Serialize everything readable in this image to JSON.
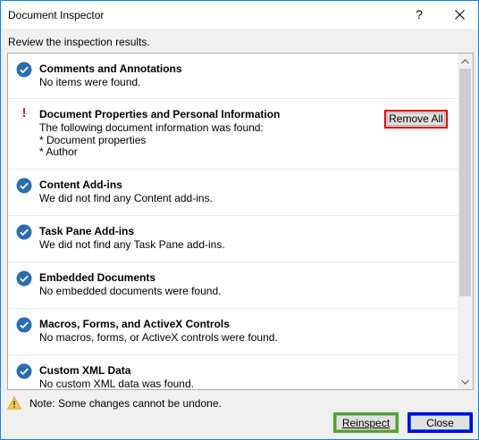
{
  "window": {
    "title": "Document Inspector",
    "help_label": "?",
    "subtitle": "Review the inspection results."
  },
  "items": [
    {
      "name": "Comments and Annotations",
      "status": "ok",
      "description": "No items were found."
    },
    {
      "name": "Document Properties and Personal Information",
      "status": "warning",
      "description": "The following document information was found:\n* Document properties\n* Author",
      "action_label": "Remove All"
    },
    {
      "name": "Content Add-ins",
      "status": "ok",
      "description": "We did not find any Content add-ins."
    },
    {
      "name": "Task Pane Add-ins",
      "status": "ok",
      "description": "We did not find any Task Pane add-ins."
    },
    {
      "name": "Embedded Documents",
      "status": "ok",
      "description": "No embedded documents were found."
    },
    {
      "name": "Macros, Forms, and ActiveX Controls",
      "status": "ok",
      "description": "No macros, forms, or ActiveX controls were found."
    },
    {
      "name": "Custom XML Data",
      "status": "ok",
      "description": "No custom XML data was found."
    }
  ],
  "footer": {
    "note": "Note: Some changes cannot be undone.",
    "reinspect_label": "Reinspect",
    "close_label": "Close"
  },
  "colors": {
    "check": "#2b6cb0",
    "warning": "#c42b1c",
    "highlight_remove": "#e00000",
    "highlight_reinspect": "#4ea72e",
    "highlight_close": "#0000e0"
  },
  "icons": {
    "ok": "check-circle-icon",
    "warning": "exclamation-icon",
    "note": "warning-triangle-icon"
  }
}
